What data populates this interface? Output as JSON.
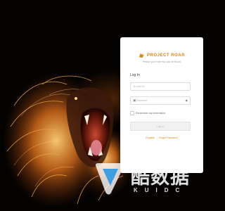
{
  "brand": {
    "name": "PROJECT ROAR",
    "tagline": "Please your enter two and sit it load",
    "logo_icon": "lion-logo-icon",
    "accent_color": "#d98a1a"
  },
  "login": {
    "heading": "Log In",
    "username": {
      "placeholder": "User ID",
      "icon": "user-icon"
    },
    "password": {
      "placeholder": "Password",
      "icon": "lock-icon",
      "toggle_icon": "eye-icon"
    },
    "remember_label": "Remember my information",
    "submit_label": "Log In",
    "register_link": "Register",
    "separator": "|",
    "forgot_link": "Forget Password"
  },
  "watermark": {
    "title": "酷数据",
    "subtitle": "KUIDC"
  }
}
